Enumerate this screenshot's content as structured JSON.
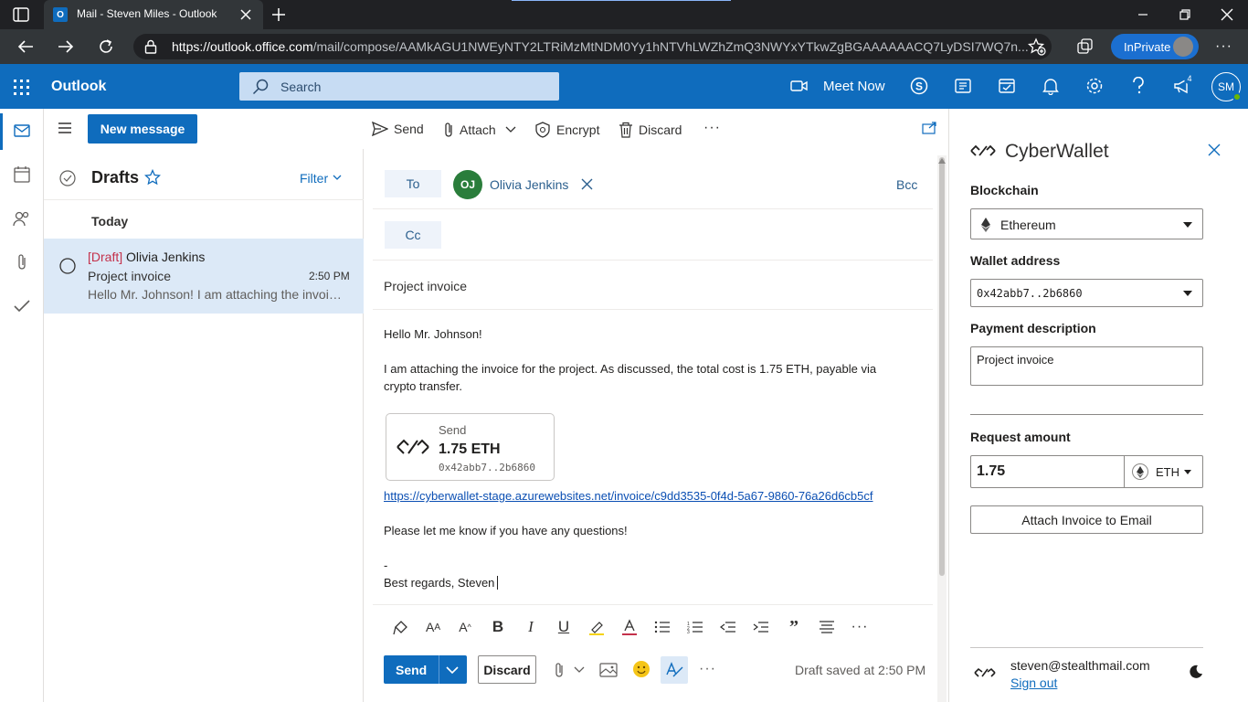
{
  "browser": {
    "tab_title": "Mail - Steven Miles - Outlook",
    "url_host": "https://outlook.office.com",
    "url_path": "/mail/compose/AAMkAGU1NWEyNTY2LTRiMzMtNDM0Yy1hNTVhLWZhZmQ3NWYxYTkwZgBGAAAAAACQ7LyDSI7WQ7n...",
    "inprivate_label": "InPrivate"
  },
  "header": {
    "app_name": "Outlook",
    "search_placeholder": "Search",
    "meet_now": "Meet Now",
    "notifications_badge": "4",
    "avatar_initials": "SM"
  },
  "folder_pane": {
    "new_message": "New message",
    "folder_title": "Drafts",
    "filter_label": "Filter",
    "group_label": "Today",
    "message": {
      "draft_tag": "[Draft]",
      "from": "Olivia Jenkins",
      "subject": "Project invoice",
      "time": "2:50 PM",
      "preview": "Hello Mr. Johnson! I am attaching the invoice for the project. As discussed..."
    }
  },
  "compose_toolbar": {
    "send": "Send",
    "attach": "Attach",
    "encrypt": "Encrypt",
    "discard": "Discard"
  },
  "compose": {
    "to_label": "To",
    "cc_label": "Cc",
    "bcc_label": "Bcc",
    "recipient_initials": "OJ",
    "recipient_name": "Olivia Jenkins",
    "subject": "Project invoice",
    "greeting": "Hello Mr. Johnson!",
    "para1_line1": "I am attaching the invoice for the project. As discussed, the total cost is 1.75 ETH, payable via",
    "para1_line2": "crypto transfer.",
    "card_label": "Send",
    "card_amount": "1.75 ETH",
    "card_address": "0x42abb7..2b6860",
    "invoice_link": "https://cyberwallet-stage.azurewebsites.net/invoice/c9dd3535-0f4d-5a67-9860-76a26d6cb5cf",
    "questions": "Please let me know if you have any questions!",
    "sig_dash": "-",
    "signoff": "Best regards, Steven",
    "send_button": "Send",
    "discard_button": "Discard",
    "draft_status": "Draft saved at 2:50 PM"
  },
  "wallet": {
    "title": "CyberWallet",
    "blockchain_label": "Blockchain",
    "blockchain_value": "Ethereum",
    "address_label": "Wallet address",
    "address_value": "0x42abb7..2b6860",
    "desc_label": "Payment description",
    "desc_value": "Project invoice",
    "amount_label": "Request amount",
    "amount_value": "1.75",
    "unit_value": "ETH",
    "attach_button": "Attach Invoice to Email",
    "user_email": "steven@stealthmail.com",
    "sign_out": "Sign out"
  },
  "colors": {
    "outlook_blue": "#0f6cbd",
    "selected_item": "#dce9f7",
    "draft_tag": "#c4314b"
  }
}
